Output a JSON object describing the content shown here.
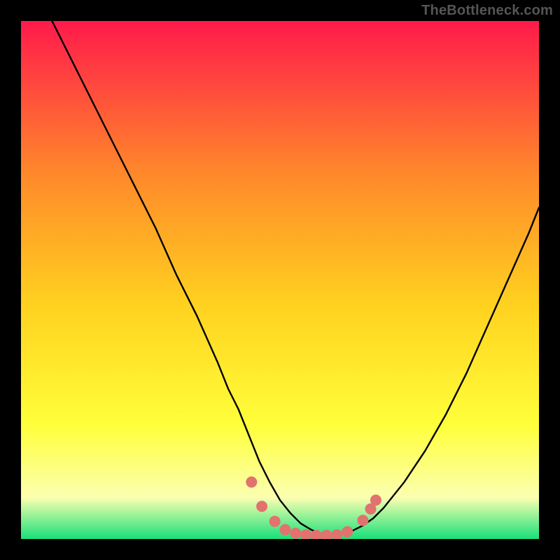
{
  "watermark": "TheBottleneck.com",
  "colors": {
    "bg": "#000000",
    "gradient_top": "#ff1a4b",
    "gradient_mid1": "#ff8a2a",
    "gradient_mid2": "#ffd21f",
    "gradient_mid3": "#ffff3a",
    "gradient_pale": "#fbffb0",
    "gradient_bottom": "#18e07a",
    "curve": "#000000",
    "marker_fill": "#e2726e",
    "marker_stroke": "#c94b46"
  },
  "chart_data": {
    "type": "line",
    "title": "",
    "xlabel": "",
    "ylabel": "",
    "xlim": [
      0,
      100
    ],
    "ylim": [
      0,
      100
    ],
    "series": [
      {
        "name": "left-curve",
        "x": [
          6,
          10,
          14,
          18,
          22,
          26,
          30,
          34,
          38,
          40,
          42,
          44,
          46,
          48,
          50,
          52,
          54,
          56,
          58,
          60
        ],
        "y": [
          100,
          92,
          84,
          76,
          68,
          60,
          51,
          43,
          34,
          29,
          25,
          20,
          15,
          11,
          7.5,
          5,
          3,
          1.8,
          1,
          0.7
        ]
      },
      {
        "name": "right-curve",
        "x": [
          60,
          62,
          64,
          66,
          68,
          70,
          74,
          78,
          82,
          86,
          90,
          94,
          98,
          100
        ],
        "y": [
          0.7,
          1,
          1.6,
          2.6,
          4,
          6,
          11,
          17,
          24,
          32,
          41,
          50,
          59,
          64
        ]
      }
    ],
    "markers": [
      {
        "x": 44.5,
        "y": 11.0
      },
      {
        "x": 46.5,
        "y": 6.3
      },
      {
        "x": 49.0,
        "y": 3.4
      },
      {
        "x": 51.0,
        "y": 1.8
      },
      {
        "x": 53.0,
        "y": 1.1
      },
      {
        "x": 55.0,
        "y": 0.8
      },
      {
        "x": 57.0,
        "y": 0.7
      },
      {
        "x": 59.0,
        "y": 0.7
      },
      {
        "x": 61.0,
        "y": 0.8
      },
      {
        "x": 63.0,
        "y": 1.4
      },
      {
        "x": 66.0,
        "y": 3.6
      },
      {
        "x": 67.5,
        "y": 5.8
      },
      {
        "x": 68.5,
        "y": 7.5
      }
    ]
  }
}
